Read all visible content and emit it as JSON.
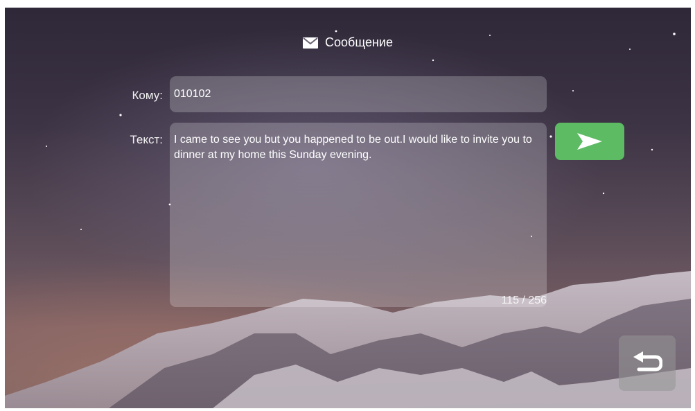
{
  "header": {
    "title": "Сообщение",
    "icon": "envelope-icon"
  },
  "form": {
    "to_label": "Кому:",
    "to_value": "010102",
    "text_label": "Текст:",
    "text_value": "I came to see you but you happened to be out.I would like to invite you to dinner at my home this Sunday evening.",
    "char_counter": "115 / 256"
  },
  "actions": {
    "send_icon": "send-arrow-icon",
    "back_icon": "return-arrow-icon"
  },
  "colors": {
    "send_button": "#5dbb63",
    "field_background": "rgba(255,255,255,0.22)"
  }
}
